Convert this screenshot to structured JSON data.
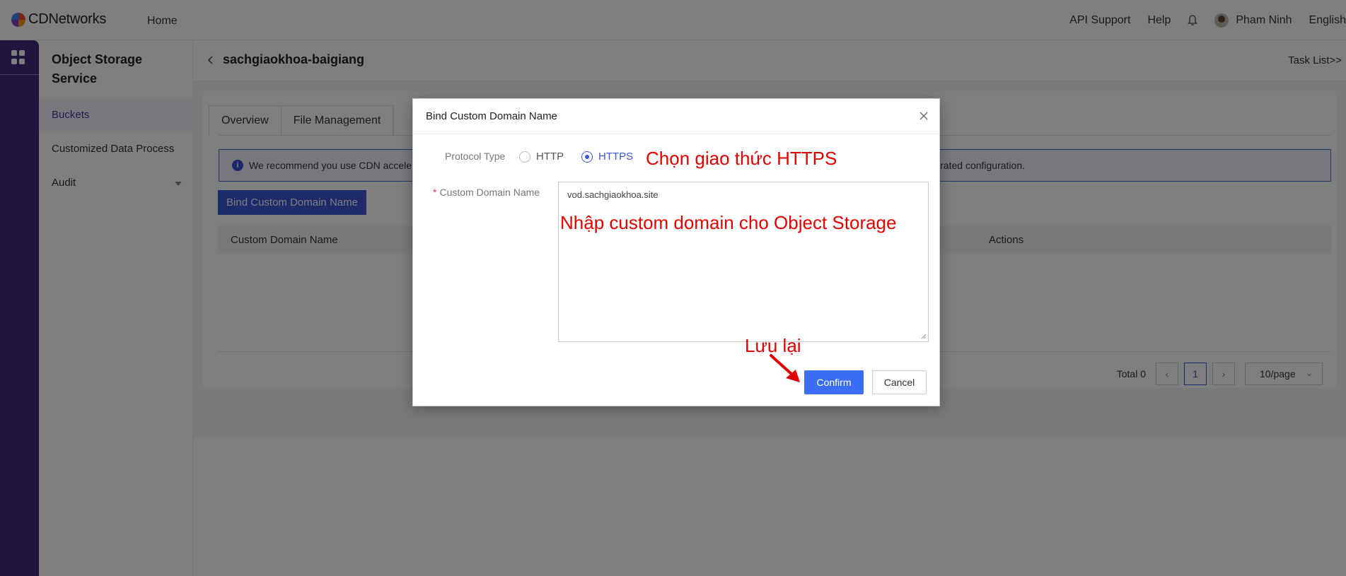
{
  "app": {
    "logo_text": "CDNetworks",
    "nav_home": "Home",
    "api_support": "API Support",
    "help": "Help",
    "user_name": "Pham Ninh",
    "language": "English"
  },
  "sidebar": {
    "title": "Object Storage Service",
    "items": [
      {
        "label": "Buckets",
        "active": true
      },
      {
        "label": "Customized Data Process",
        "active": false
      },
      {
        "label": "Audit",
        "active": false
      }
    ]
  },
  "page": {
    "title": "sachgiaokhoa-baigiang",
    "task_list": "Task List>>",
    "tabs": [
      "Overview",
      "File Management"
    ],
    "notice_left": "We recommend you use CDN accele",
    "notice_right": "rated configuration.",
    "bind_button": "Bind Custom Domain Name",
    "columns": [
      "Custom Domain Name",
      "Actions"
    ],
    "pager": {
      "total": "Total 0",
      "current_page": "1",
      "page_size": "10/page"
    }
  },
  "modal": {
    "title": "Bind Custom Domain Name",
    "protocol_label": "Protocol Type",
    "protocol_options": [
      "HTTP",
      "HTTPS"
    ],
    "protocol_selected": "HTTPS",
    "domain_label": "Custom Domain Name",
    "domain_value": "vod.sachgiaokhoa.site",
    "confirm": "Confirm",
    "cancel": "Cancel"
  },
  "annotations": {
    "choose_https": "Chọn giao thức HTTPS",
    "enter_domain": "Nhập custom domain cho Object Storage",
    "save": "Lưu lại",
    "color": "#e00000"
  },
  "colors": {
    "rail": "#3f2a7c",
    "primary": "#3b56d6",
    "confirm": "#3b6df5"
  }
}
